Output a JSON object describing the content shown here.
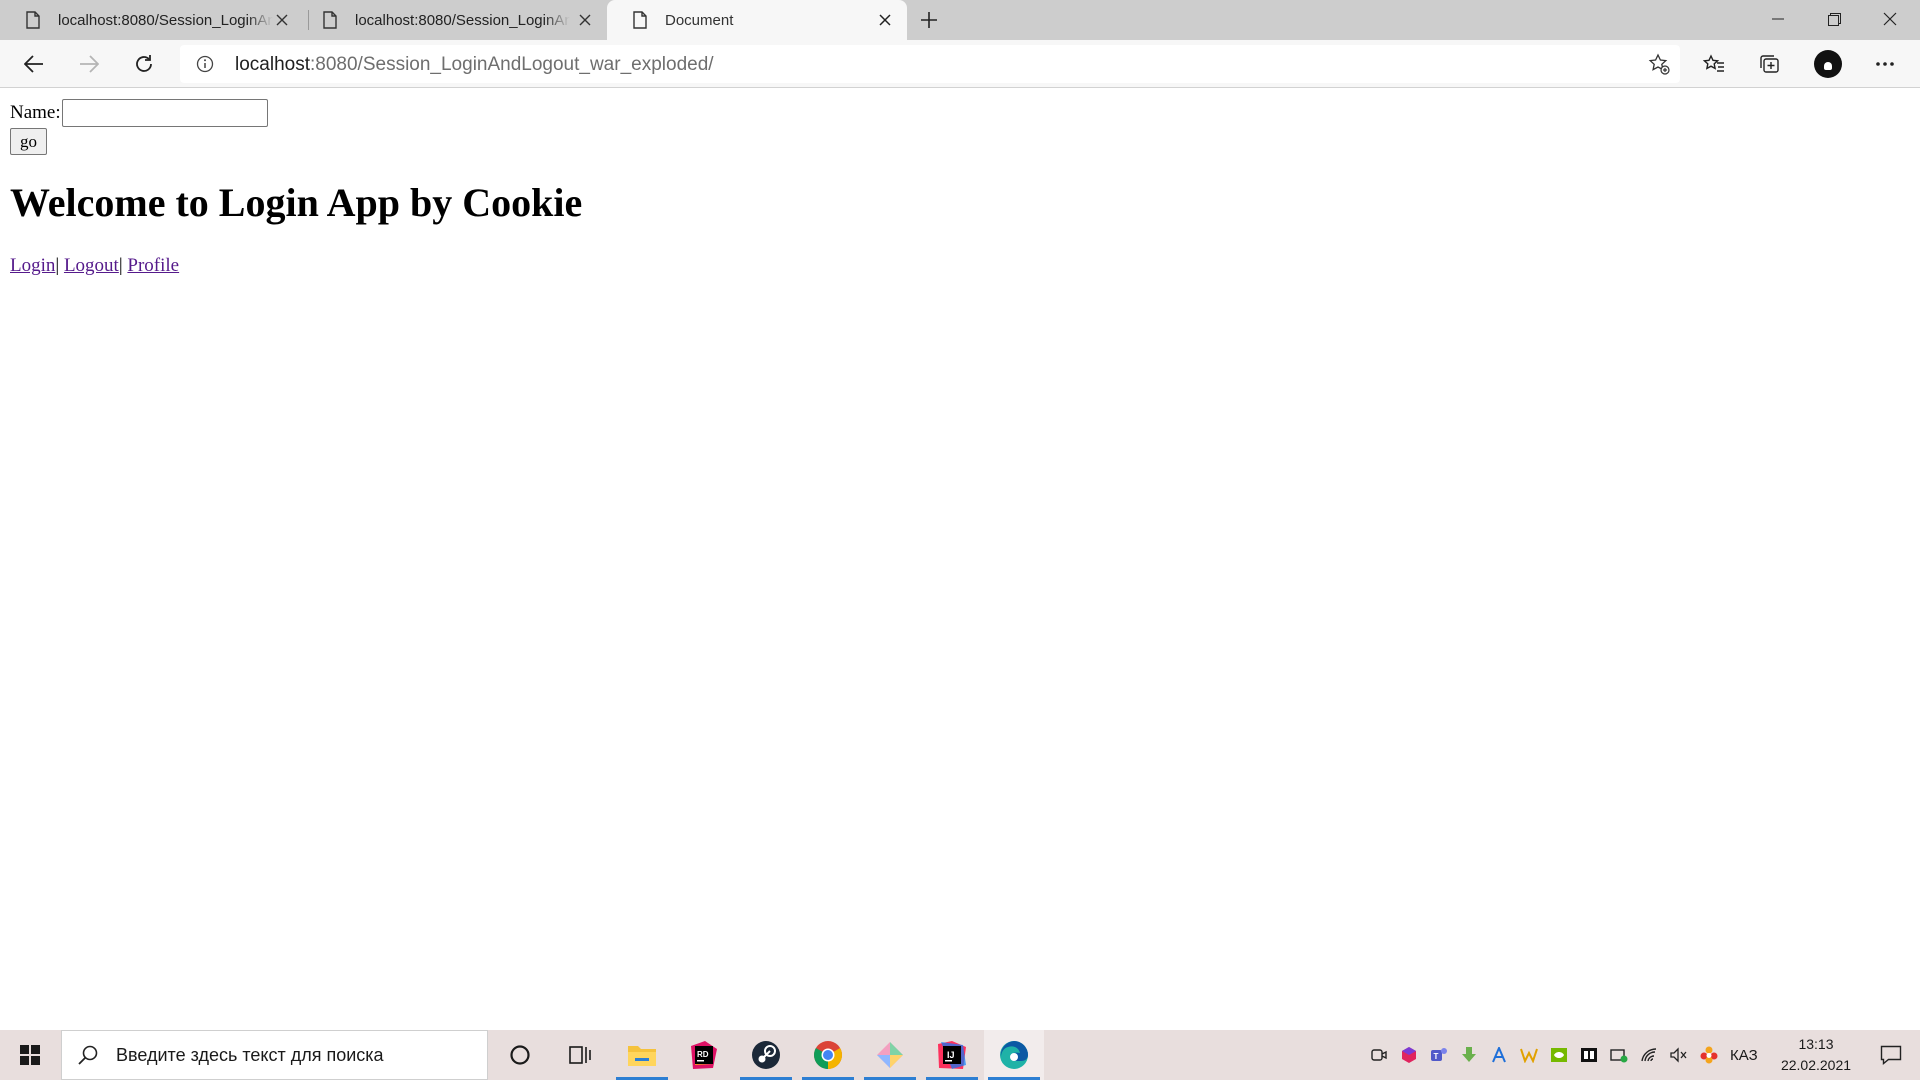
{
  "browser": {
    "tabs": [
      {
        "title": "localhost:8080/Session_LoginAndLogout_war_exploded/",
        "active": false
      },
      {
        "title": "localhost:8080/Session_LoginAndLogout_war_exploded/",
        "active": false
      },
      {
        "title": "Document",
        "active": true
      }
    ],
    "address": {
      "host": "localhost",
      "rest": ":8080/Session_LoginAndLogout_war_exploded/"
    }
  },
  "page": {
    "name_label": "Name:",
    "name_value": "",
    "go_label": "go",
    "heading": "Welcome to Login App by Cookie",
    "links": {
      "login": "Login",
      "logout": "Logout",
      "profile": "Profile",
      "separator": "|"
    }
  },
  "taskbar": {
    "search_placeholder": "Введите здесь текст для поиска",
    "apps": [
      "task-view-icon",
      "file-explorer-icon",
      "rider-icon",
      "steam-icon",
      "chrome-icon",
      "kite-icon",
      "intellij-icon",
      "edge-icon"
    ],
    "language": "КАЗ",
    "time": "13:13",
    "date": "22.02.2021"
  },
  "colors": {
    "tabstrip": "#cdcdcd",
    "toolbar": "#f7f7f7",
    "visited_link": "#551a8b",
    "taskbar": "#e8dedd",
    "running_indicator": "#2d7fd3"
  }
}
